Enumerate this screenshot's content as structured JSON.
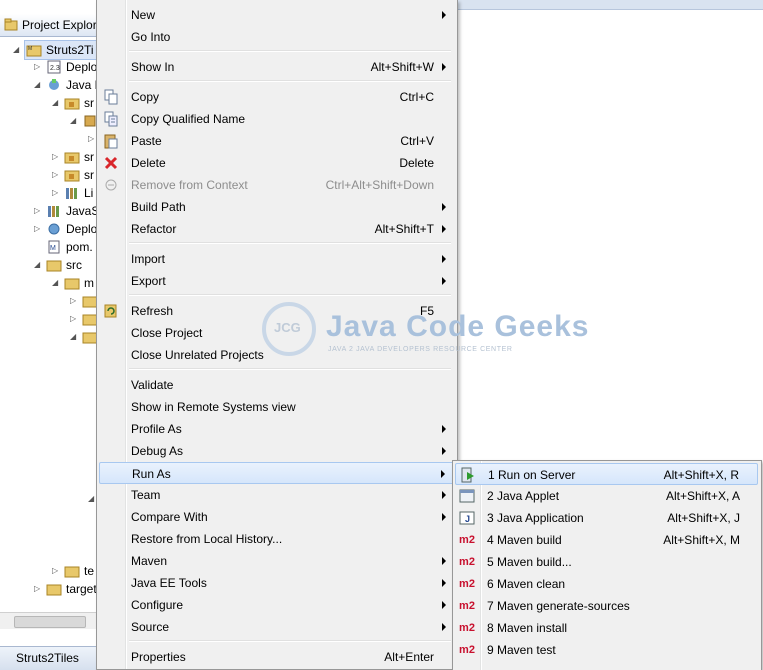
{
  "explorer": {
    "title": "Project Explor",
    "rows": [
      {
        "text": "Struts2Ti",
        "selected": true
      },
      {
        "text": "Deplo"
      },
      {
        "text": "Java R"
      },
      {
        "text": "sr"
      },
      {
        "text": ""
      },
      {
        "text": ""
      },
      {
        "text": "sr"
      },
      {
        "text": "sr"
      },
      {
        "text": "Li"
      },
      {
        "text": "JavaS"
      },
      {
        "text": "Deplo"
      },
      {
        "text": "pom."
      },
      {
        "text": "src"
      },
      {
        "text": "m"
      },
      {
        "text": ""
      },
      {
        "text": ""
      },
      {
        "text": ""
      },
      {
        "text": "te"
      },
      {
        "text": "target"
      }
    ],
    "bottom_tab": "Struts2Tiles"
  },
  "menu": {
    "items": [
      {
        "label": "New",
        "shortcut": "",
        "submenu": true
      },
      {
        "label": "Go Into",
        "shortcut": ""
      },
      {
        "label": "Show In",
        "shortcut": "Alt+Shift+W",
        "submenu": true
      },
      {
        "label": "Copy",
        "shortcut": "Ctrl+C",
        "icon": "copy-icon"
      },
      {
        "label": "Copy Qualified Name",
        "shortcut": "",
        "icon": "copy-qualified-icon"
      },
      {
        "label": "Paste",
        "shortcut": "Ctrl+V",
        "icon": "paste-icon"
      },
      {
        "label": "Delete",
        "shortcut": "Delete",
        "icon": "delete-icon"
      },
      {
        "label": "Remove from Context",
        "shortcut": "Ctrl+Alt+Shift+Down",
        "icon": "remove-context-icon",
        "disabled": true
      },
      {
        "label": "Build Path",
        "shortcut": "",
        "submenu": true
      },
      {
        "label": "Refactor",
        "shortcut": "Alt+Shift+T",
        "submenu": true
      },
      {
        "label": "Import",
        "shortcut": "",
        "submenu": true
      },
      {
        "label": "Export",
        "shortcut": "",
        "submenu": true
      },
      {
        "label": "Refresh",
        "shortcut": "F5",
        "icon": "refresh-icon"
      },
      {
        "label": "Close Project",
        "shortcut": ""
      },
      {
        "label": "Close Unrelated Projects",
        "shortcut": ""
      },
      {
        "label": "Validate",
        "shortcut": ""
      },
      {
        "label": "Show in Remote Systems view",
        "shortcut": ""
      },
      {
        "label": "Profile As",
        "shortcut": "",
        "submenu": true
      },
      {
        "label": "Debug As",
        "shortcut": "",
        "submenu": true
      },
      {
        "label": "Run As",
        "shortcut": "",
        "submenu": true,
        "highlighted": true
      },
      {
        "label": "Team",
        "shortcut": "",
        "submenu": true
      },
      {
        "label": "Compare With",
        "shortcut": "",
        "submenu": true
      },
      {
        "label": "Restore from Local History...",
        "shortcut": ""
      },
      {
        "label": "Maven",
        "shortcut": "",
        "submenu": true
      },
      {
        "label": "Java EE Tools",
        "shortcut": "",
        "submenu": true
      },
      {
        "label": "Configure",
        "shortcut": "",
        "submenu": true
      },
      {
        "label": "Source",
        "shortcut": "",
        "submenu": true
      },
      {
        "label": "Properties",
        "shortcut": "Alt+Enter"
      }
    ]
  },
  "run_as": {
    "items": [
      {
        "label": "1 Run on Server",
        "shortcut": "Alt+Shift+X, R",
        "icon": "run-on-server-icon",
        "highlighted": true
      },
      {
        "label": "2 Java Applet",
        "shortcut": "Alt+Shift+X, A",
        "icon": "java-applet-icon"
      },
      {
        "label": "3 Java Application",
        "shortcut": "Alt+Shift+X, J",
        "icon": "java-application-icon"
      },
      {
        "label": "4 Maven build",
        "shortcut": "Alt+Shift+X, M",
        "icon": "m2-icon"
      },
      {
        "label": "5 Maven build...",
        "shortcut": "",
        "icon": "m2-icon"
      },
      {
        "label": "6 Maven clean",
        "shortcut": "",
        "icon": "m2-icon"
      },
      {
        "label": "7 Maven generate-sources",
        "shortcut": "",
        "icon": "m2-icon"
      },
      {
        "label": "8 Maven install",
        "shortcut": "",
        "icon": "m2-icon"
      },
      {
        "label": "9 Maven test",
        "shortcut": "",
        "icon": "m2-icon"
      }
    ],
    "m2_text": "m2"
  },
  "watermark": {
    "logo": "JCG",
    "title": "Java Code Geeks",
    "subtitle": "JAVA 2 JAVA DEVELOPERS RESOURCE CENTER"
  },
  "colors": {
    "menu_bg": "#f0f0f0",
    "highlight": "#d6e6fb",
    "m2_red": "#c8102e",
    "delete_red": "#d9262b"
  }
}
